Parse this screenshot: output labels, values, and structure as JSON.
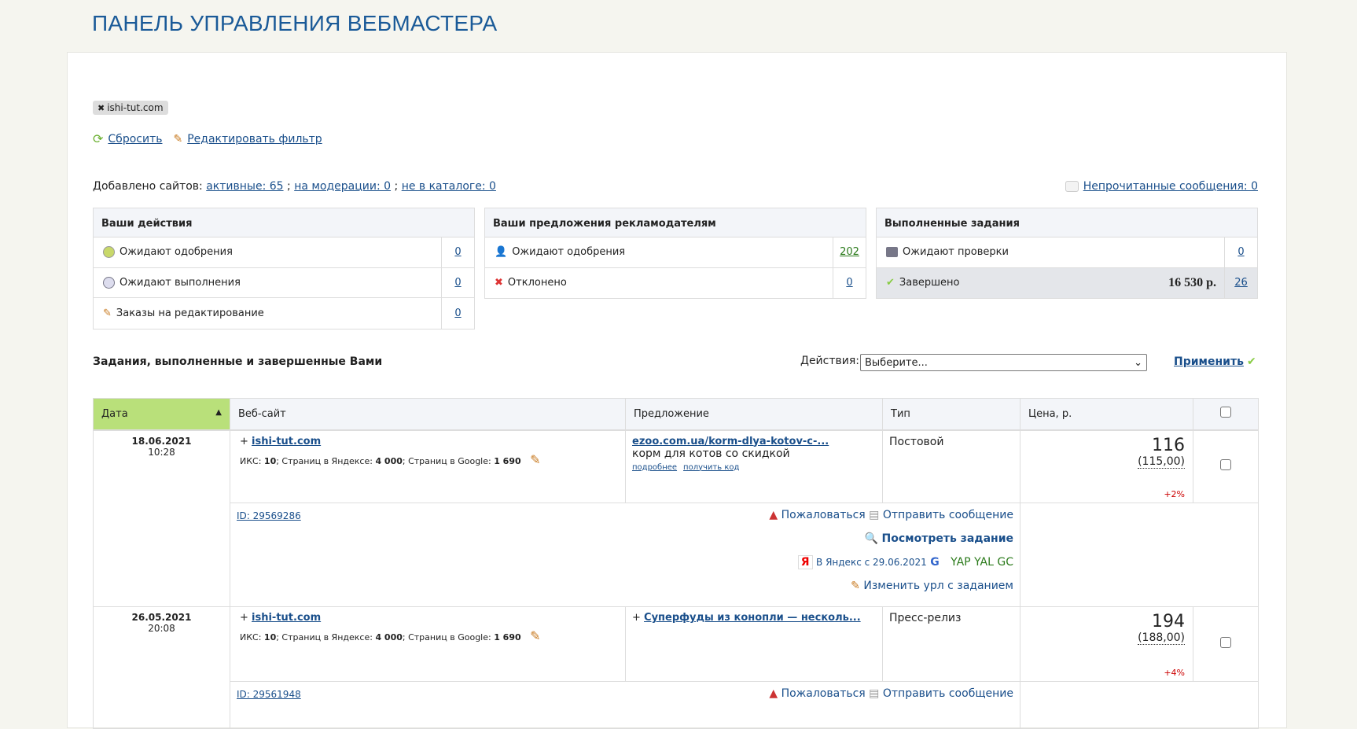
{
  "title": "ПАНЕЛЬ УПРАВЛЕНИЯ ВЕБМАСТЕРА",
  "filter_tag": "ishi-tut.com",
  "reset": "Сбросить",
  "edit_filter": "Редактировать фильтр",
  "added": {
    "label": "Добавлено сайтов:",
    "active": "активные: 65",
    "moderation": "на модерации: 0",
    "not_catalog": "не в каталоге: 0"
  },
  "unread": "Непрочитанные сообщения: 0",
  "boxes": [
    {
      "title": "Ваши действия",
      "rows": [
        {
          "label": "Ожидают одобрения",
          "value": "0"
        },
        {
          "label": "Ожидают выполнения",
          "value": "0"
        },
        {
          "label": "Заказы на редактирование",
          "value": "0"
        }
      ]
    },
    {
      "title": "Ваши предложения рекламодателям",
      "rows": [
        {
          "label": "Ожидают одобрения",
          "value": "202"
        },
        {
          "label": "Отклонено",
          "value": "0"
        }
      ]
    },
    {
      "title": "Выполненные задания",
      "rows": [
        {
          "label": "Ожидают проверки",
          "value": "0"
        },
        {
          "label": "Завершено",
          "amount": "16 530 р.",
          "value": "26"
        }
      ]
    }
  ],
  "section_title": "Задания, выполненные и завершенные Вами",
  "actions_label": "Действия:",
  "actions_select": "Выберите...",
  "apply": "Применить",
  "columns": [
    "Дата",
    "Веб-сайт",
    "Предложение",
    "Тип",
    "Цена, р."
  ],
  "rows": [
    {
      "date": "18.06.2021",
      "time": "10:28",
      "site": "ishi-tut.com",
      "iks": "10",
      "yandex_pages": "4 000",
      "google_pages": "1 690",
      "offer_link": "ezoo.com.ua/korm-dlya-kotov-c-...",
      "offer_text": "корм для котов со скидкой",
      "more": "подробнее",
      "get_code": "получить код",
      "type": "Постовой",
      "price": "116",
      "price_old": "(115,00)",
      "pct": "+2%",
      "id": "ID: 29569286",
      "complain": "Пожаловаться",
      "message": "Отправить сообщение",
      "view": "Посмотреть задание",
      "yandex_since": "В Яндекс с 29.06.2021",
      "indexes": "YAP YAL GC",
      "change_url": "Изменить урл с заданием"
    },
    {
      "date": "26.05.2021",
      "time": "20:08",
      "site": "ishi-tut.com",
      "iks": "10",
      "yandex_pages": "4 000",
      "google_pages": "1 690",
      "offer_link": "Суперфуды из конопли — несколь...",
      "type": "Пресс-релиз",
      "price": "194",
      "price_old": "(188,00)",
      "pct": "+4%",
      "id": "ID: 29561948",
      "complain": "Пожаловаться",
      "message": "Отправить сообщение"
    }
  ],
  "meta_labels": {
    "iks": "ИКС: ",
    "yandex": "; Страниц в Яндексе: ",
    "google": "; Страниц в Google: "
  },
  "colors": {
    "accent": "#1a5a98",
    "sorted": "#b9e07a"
  }
}
